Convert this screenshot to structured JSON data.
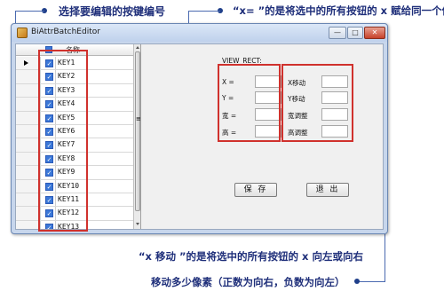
{
  "annotations": {
    "top_left": "选择要编辑的按键编号",
    "top_right": "“x= ”的是将选中的所有按钮的 x 赋给同一个值",
    "bottom_line1": "“x 移动 ”的是将选中的所有按钮的 x 向左或向右",
    "bottom_line2": "移动多少像素（正数为向右，负数为向左）"
  },
  "window": {
    "title": "BiAttrBatchEditor",
    "controls": {
      "minimize": "—",
      "maximize": "□",
      "close": "✕"
    }
  },
  "grid": {
    "header_label": "名称",
    "rows": [
      "KEY1",
      "KEY2",
      "KEY3",
      "KEY4",
      "KEY5",
      "KEY6",
      "KEY7",
      "KEY8",
      "KEY9",
      "KEY10",
      "KEY11",
      "KEY12",
      "KEY13"
    ],
    "check_mark": "✓",
    "scroll_grip": "≡"
  },
  "panel": {
    "group_label": "VIEW_RECT:",
    "left_fields": [
      "X =",
      "Y =",
      "宽 =",
      "高 ="
    ],
    "right_fields": [
      "X移动",
      "Y移动",
      "宽调整",
      "高调整"
    ],
    "save_label": "保 存",
    "exit_label": "退 出"
  }
}
